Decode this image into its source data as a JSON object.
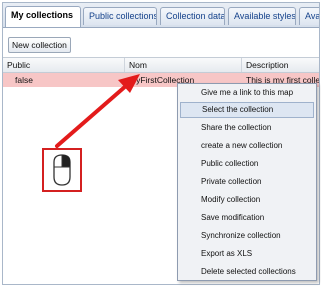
{
  "tabs": [
    {
      "label": "My collections",
      "active": true
    },
    {
      "label": "Public collections",
      "active": false
    },
    {
      "label": "Collection data",
      "active": false
    },
    {
      "label": "Available styles",
      "active": false
    },
    {
      "label": "Availa",
      "active": false
    }
  ],
  "toolbar": {
    "new_collection_label": "New collection"
  },
  "grid": {
    "columns": [
      "Public",
      "Nom",
      "Description"
    ],
    "rows": [
      {
        "public": "false",
        "nom": "MyFirstCollection",
        "description": "This is my first collec"
      }
    ],
    "selected_row_color": "#f7c6c6"
  },
  "context_menu": {
    "items": [
      {
        "label": "Give me a link to this map"
      },
      {
        "label": "Select the collection",
        "highlighted": true
      },
      {
        "label": "Share the collection"
      },
      {
        "label": "create a new collection"
      },
      {
        "label": "Public collection"
      },
      {
        "label": "Private collection"
      },
      {
        "label": "Modify collection"
      },
      {
        "label": "Save modification"
      },
      {
        "label": "Synchronize collection"
      },
      {
        "label": "Export as XLS"
      },
      {
        "label": "Delete selected collections"
      }
    ]
  },
  "annotation": {
    "arrow_color": "#e31b1b",
    "mouse_icon": "mouse-right-click-icon"
  }
}
